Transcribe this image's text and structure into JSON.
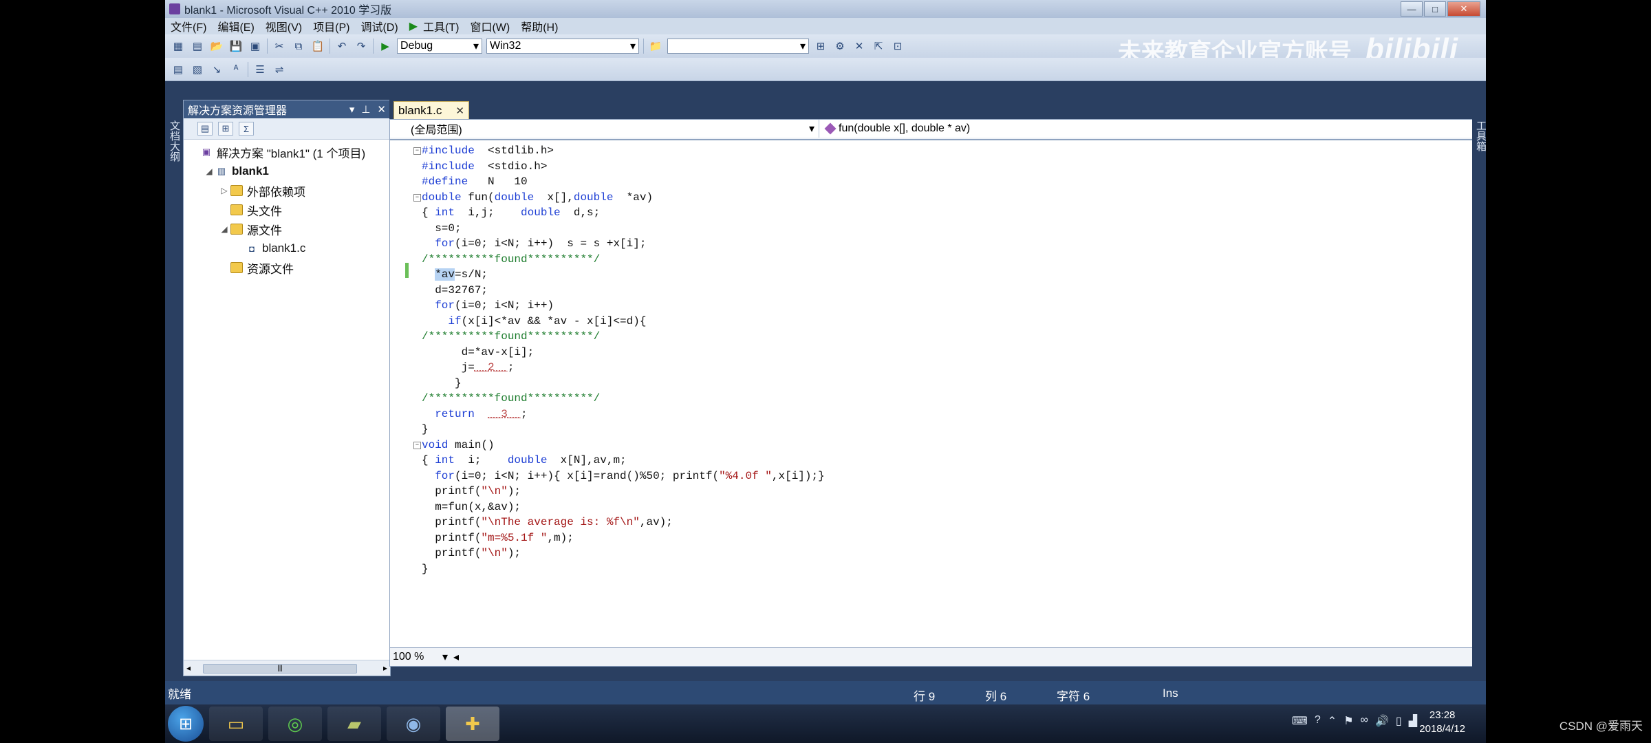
{
  "window": {
    "title": "blank1 - Microsoft Visual C++ 2010 学习版",
    "controls": [
      "—",
      "□",
      "✕"
    ]
  },
  "menu": [
    "文件(F)",
    "编辑(E)",
    "视图(V)",
    "项目(P)",
    "调试(D)",
    "工具(T)",
    "窗口(W)",
    "帮助(H)"
  ],
  "toolbar": {
    "config": "Debug",
    "platform": "Win32",
    "find_value": ""
  },
  "watermark": {
    "text": "未来教育企业官方账号",
    "logo": "bilibili"
  },
  "left_strip": "文档大纲",
  "right_strip": "工具箱",
  "solution_explorer": {
    "title": "解决方案资源管理器",
    "items": [
      {
        "label": "解决方案 \"blank1\" (1 个项目)",
        "icon": "solution-icon",
        "indent": 0,
        "expander": ""
      },
      {
        "label": "blank1",
        "icon": "project-icon",
        "indent": 1,
        "expander": "◢",
        "bold": true
      },
      {
        "label": "外部依赖项",
        "icon": "folder-icon",
        "indent": 2,
        "expander": "▷"
      },
      {
        "label": "头文件",
        "icon": "folder-icon",
        "indent": 2,
        "expander": ""
      },
      {
        "label": "源文件",
        "icon": "folder-icon",
        "indent": 2,
        "expander": "◢"
      },
      {
        "label": "blank1.c",
        "icon": "cpp-file-icon",
        "indent": 3,
        "expander": ""
      },
      {
        "label": "资源文件",
        "icon": "folder-icon",
        "indent": 2,
        "expander": ""
      }
    ]
  },
  "editor": {
    "tab": "blank1.c",
    "scope": "(全局范围)",
    "function": "fun(double x[], double * av)",
    "zoom": "100 %"
  },
  "code": [
    {
      "fold": "⊟",
      "t": "#include  <stdlib.h>"
    },
    {
      "t": "#include  <stdio.h>"
    },
    {
      "t": "#define   N   10"
    },
    {
      "fold": "⊟",
      "t": "double fun(double  x[],double  *av)"
    },
    {
      "t": "{ int  i,j;    double  d,s;"
    },
    {
      "t": "  s=0;"
    },
    {
      "t": "  for(i=0; i<N; i++)  s = s +x[i];"
    },
    {
      "t": "/**********found**********/"
    },
    {
      "t": "  *av=s/N;"
    },
    {
      "t": "  d=32767;"
    },
    {
      "t": "  for(i=0; i<N; i++)"
    },
    {
      "t": "    if(x[i]<*av && *av - x[i]<=d){"
    },
    {
      "t": "/**********found**********/"
    },
    {
      "t": "      d=*av-x[i];"
    },
    {
      "t": "      j=__2__;"
    },
    {
      "t": "     }"
    },
    {
      "t": "/**********found**********/"
    },
    {
      "t": "  return  __3__;"
    },
    {
      "t": "}"
    },
    {
      "fold": "⊟",
      "t": "void main()"
    },
    {
      "t": "{ int  i;    double  x[N],av,m;"
    },
    {
      "t": "  for(i=0; i<N; i++){ x[i]=rand()%50; printf(\"%4.0f \",x[i]);}"
    },
    {
      "t": "  printf(\"\\n\");"
    },
    {
      "t": "  m=fun(x,&av);"
    },
    {
      "t": "  printf(\"\\nThe average is: %f\\n\",av);"
    },
    {
      "t": "  printf(\"m=%5.1f \",m);"
    },
    {
      "t": "  printf(\"\\n\");"
    },
    {
      "t": "}"
    }
  ],
  "status": {
    "ready": "就绪",
    "line": "行 9",
    "col": "列 6",
    "char": "字符 6",
    "mode": "Ins"
  },
  "taskbar": {
    "time": "23:28",
    "date": "2018/4/12"
  },
  "credit": "CSDN @爱雨天"
}
